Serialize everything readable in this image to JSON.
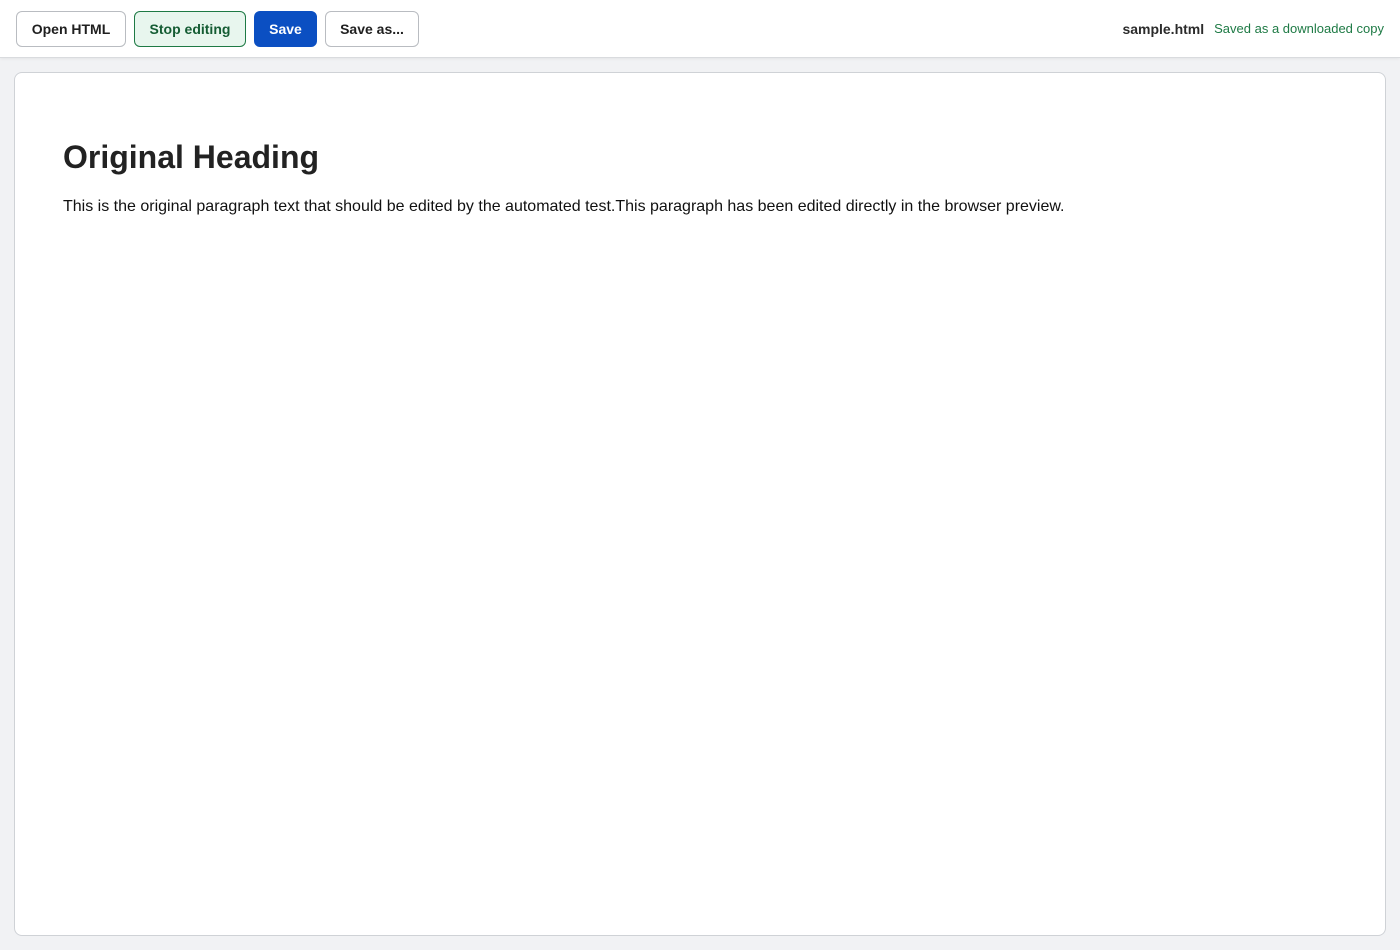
{
  "toolbar": {
    "open_label": "Open HTML",
    "stop_editing_label": "Stop editing",
    "save_label": "Save",
    "save_as_label": "Save as...",
    "filename": "sample.html",
    "status": "Saved as a downloaded copy"
  },
  "document": {
    "heading": "Original Heading",
    "paragraph": "This is the original paragraph text that should be edited by the automated test.This paragraph has been edited directly in the browser preview."
  },
  "colors": {
    "primary": "#0b4fc2",
    "success": "#1e7a45",
    "editing_bg": "#e8f6ee"
  }
}
